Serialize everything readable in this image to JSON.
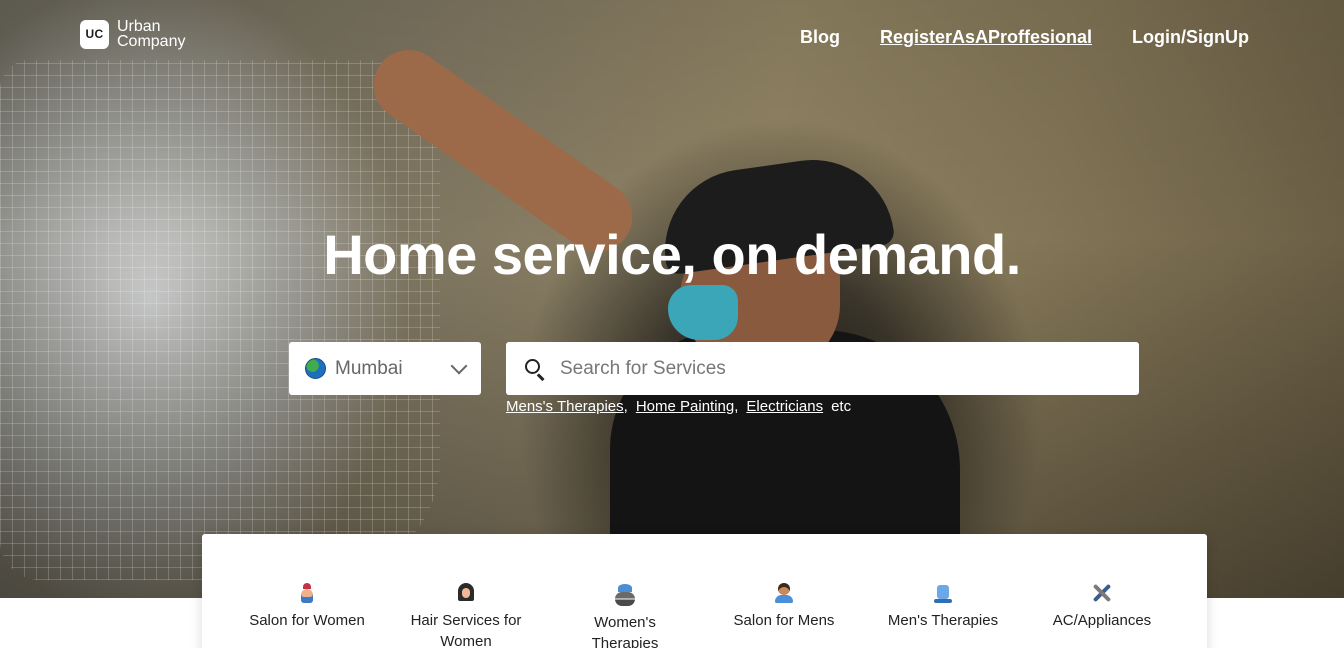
{
  "brand": {
    "logo_mark": "UC",
    "name_line1": "Urban",
    "name_line2": "Company"
  },
  "nav": {
    "links": [
      {
        "label": "Blog"
      },
      {
        "label": "RegisterAsAProffesional"
      },
      {
        "label": "Login/SignUp"
      }
    ]
  },
  "hero": {
    "headline": "Home service, on demand."
  },
  "city_select": {
    "value": "Mumbai",
    "icon": "globe-icon"
  },
  "search": {
    "placeholder": "Search for Services",
    "icon": "search-icon"
  },
  "suggestions": {
    "items": [
      "Mens's Therapies",
      "Home Painting",
      "Electricians"
    ],
    "trailing": "etc"
  },
  "services": [
    {
      "label": "Salon for Women",
      "icon": "salon-women-icon"
    },
    {
      "label": "Hair Services for Women",
      "icon": "hair-services-icon"
    },
    {
      "label": "Women's Therapies",
      "icon": "womens-therapies-icon"
    },
    {
      "label": "Salon for Mens",
      "icon": "salon-men-icon"
    },
    {
      "label": "Men's Therapies",
      "icon": "mens-therapies-icon"
    },
    {
      "label": "AC/Appliances",
      "icon": "tools-icon"
    }
  ]
}
